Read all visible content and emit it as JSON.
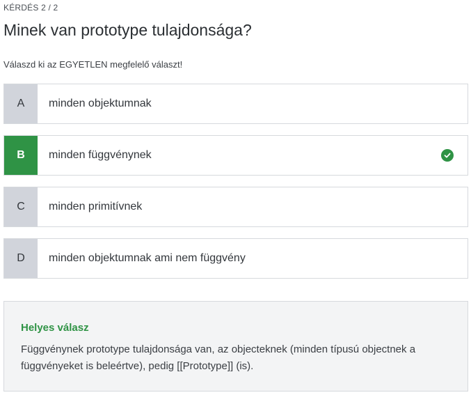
{
  "counter": "KÉRDÉS 2 / 2",
  "question": "Minek van prototype tulajdonsága?",
  "instruction": "Válaszd ki az EGYETLEN megfelelő választ!",
  "options": [
    {
      "letter": "A",
      "text": "minden objektumnak",
      "correct": false
    },
    {
      "letter": "B",
      "text": "minden függvénynek",
      "correct": true
    },
    {
      "letter": "C",
      "text": "minden primitívnek",
      "correct": false
    },
    {
      "letter": "D",
      "text": "minden objektumnak ami nem függvény",
      "correct": false
    }
  ],
  "feedback": {
    "title": "Helyes válasz",
    "body": "Függvénynek prototype tulajdonsága van, az objecteknek (minden típusú objectnek a függvényeket is beleértve), pedig [[Prototype]] (is)."
  },
  "colors": {
    "correct": "#2f9345",
    "letter_bg": "#d1d4db",
    "border": "#d6d9dd",
    "feedback_bg": "#f3f4f5"
  },
  "icons": {
    "correct": "check-circle-icon"
  }
}
